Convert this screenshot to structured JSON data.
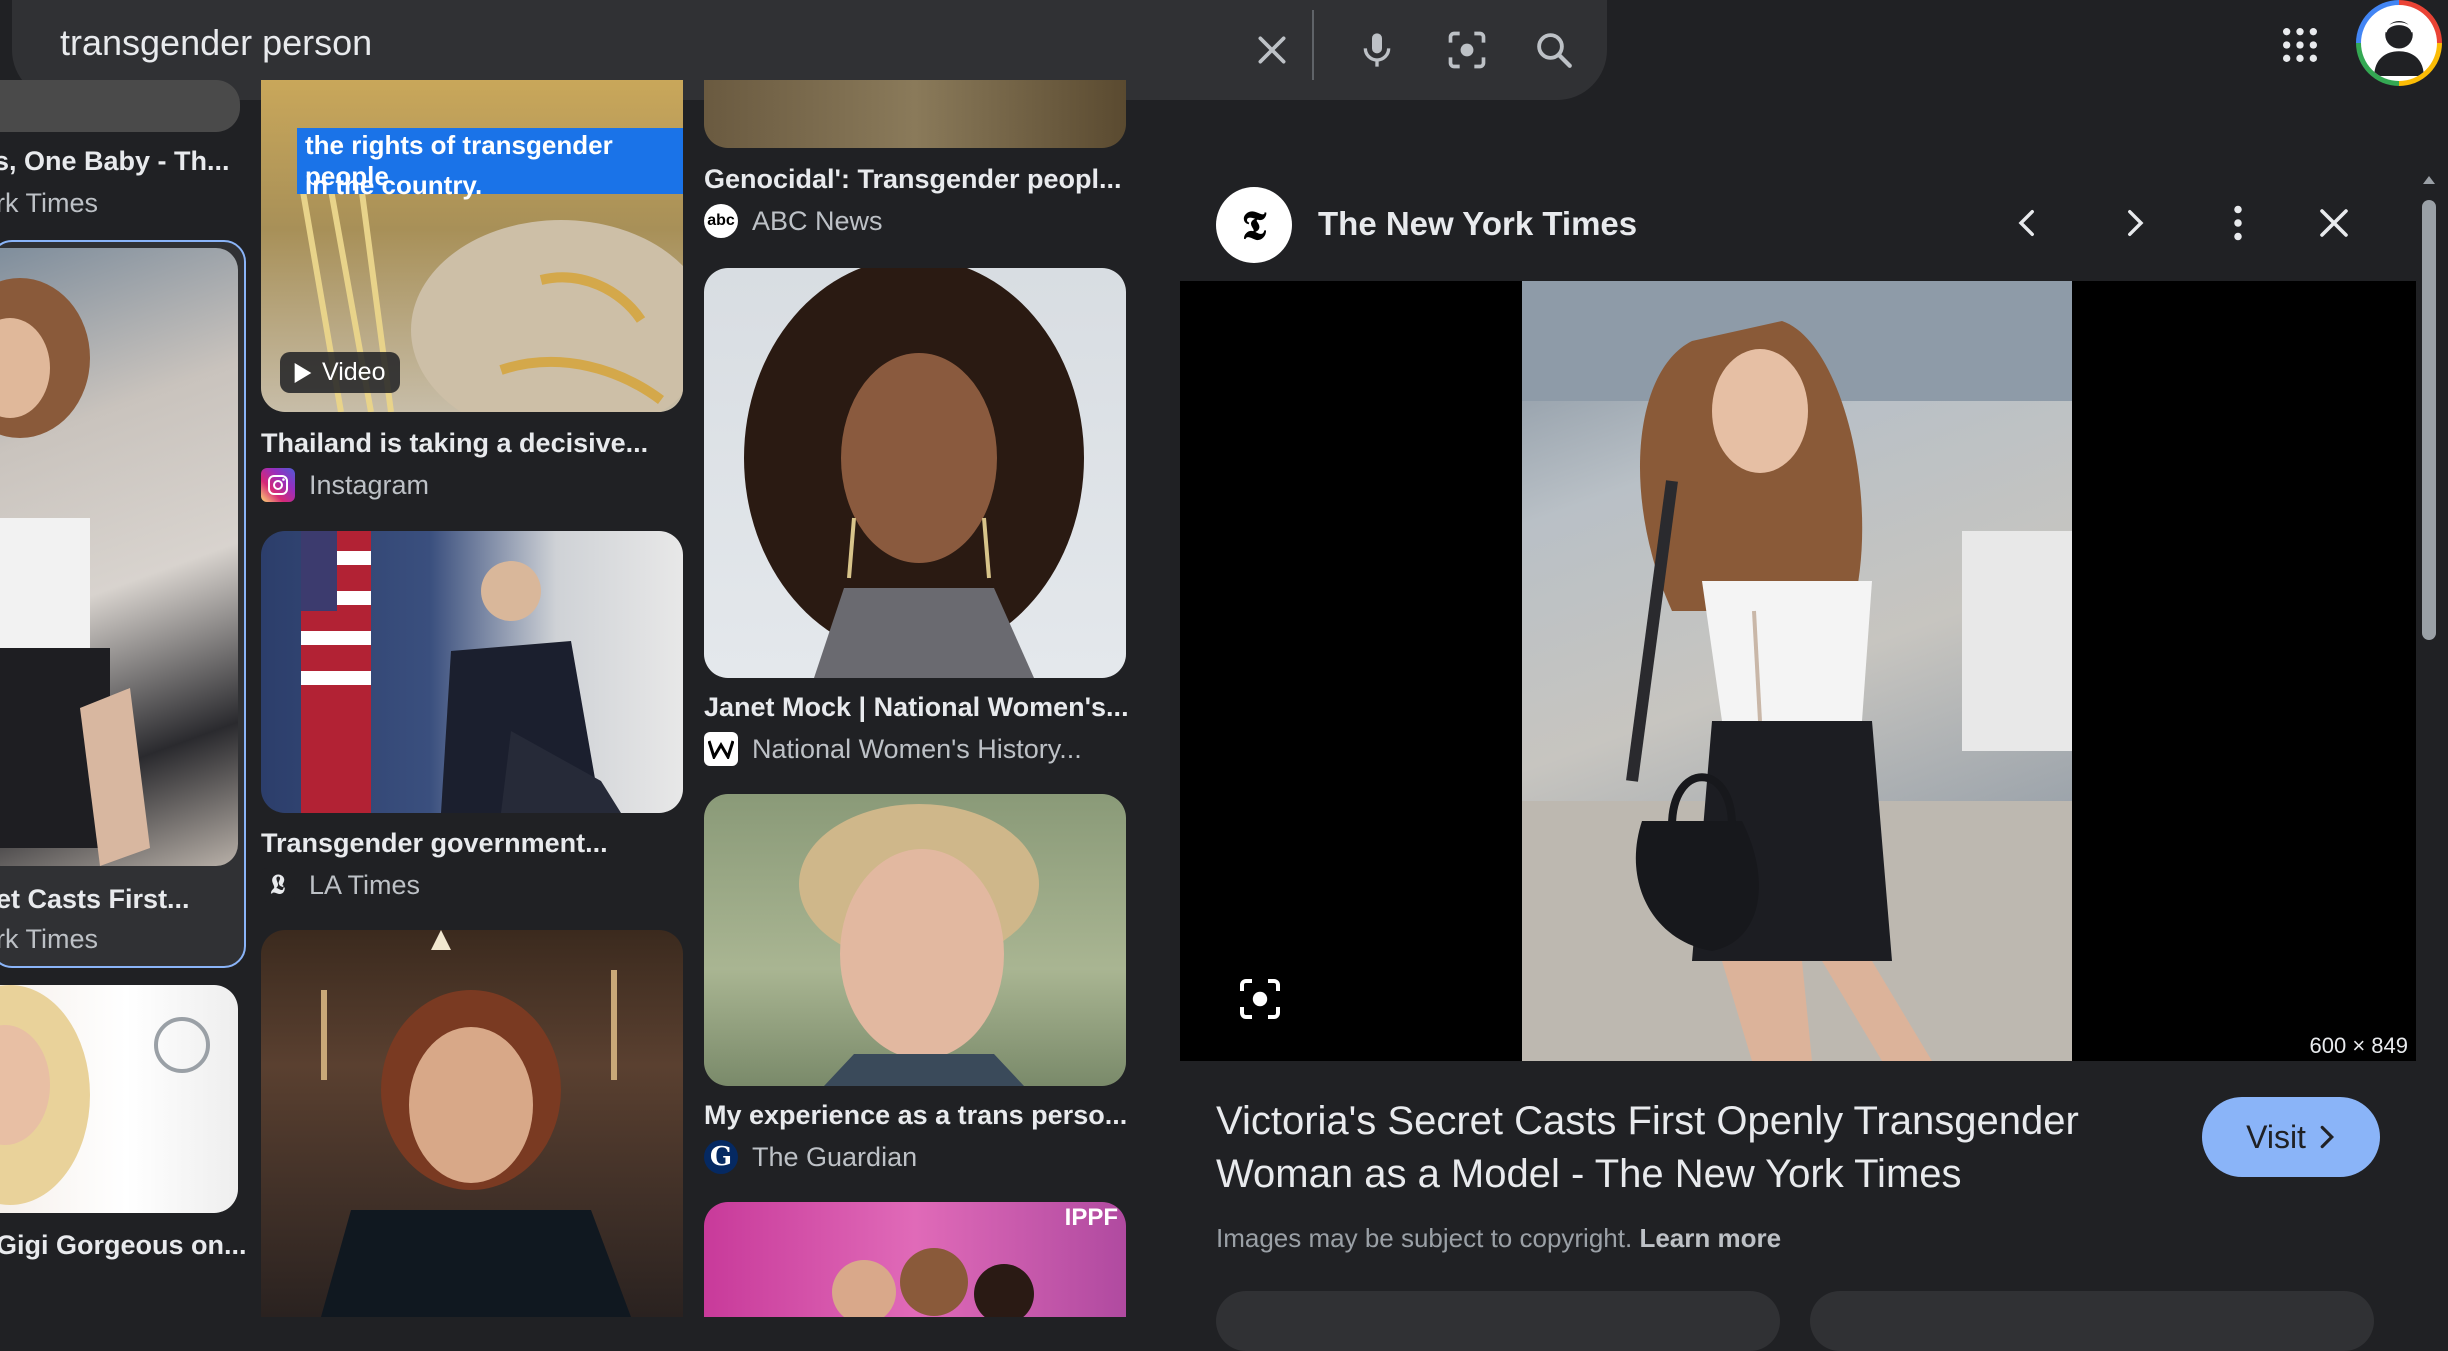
{
  "search": {
    "query": "transgender person"
  },
  "colors": {
    "background": "#202124",
    "surface": "#303134",
    "accent": "#8ab4f8"
  },
  "results": {
    "col0": [
      {
        "title": "s, One Baby - Th...",
        "source": "rk Times"
      },
      {
        "title": "et Casts First...",
        "source": "rk Times",
        "selected": true
      },
      {
        "title": "Gigi Gorgeous on..."
      }
    ],
    "col1": [
      {
        "overlay_lines": [
          "the rights of transgender people",
          "in the country."
        ],
        "badge": "Video",
        "title": "Thailand is taking a decisive...",
        "source": "Instagram"
      },
      {
        "title": "Transgender government...",
        "source": "LA Times"
      },
      {
        "title": ""
      }
    ],
    "col2": [
      {
        "title": "Genocidal': Transgender peopl...",
        "source": "ABC News",
        "favicon": "abc"
      },
      {
        "title": "Janet Mock | National Women's...",
        "source": "National Women's History..."
      },
      {
        "title": "My experience as a trans perso...",
        "source": "The Guardian",
        "favicon": "G"
      },
      {
        "overlay": "IPPF"
      }
    ]
  },
  "panel": {
    "source_name": "The New York Times",
    "source_logo": "𝕿",
    "dimensions": "600 × 849",
    "title": "Victoria's Secret Casts First Openly Transgender Woman as a Model - The New York Times",
    "visit_label": "Visit",
    "copyright_text": "Images may be subject to copyright.",
    "learn_more": "Learn more"
  }
}
